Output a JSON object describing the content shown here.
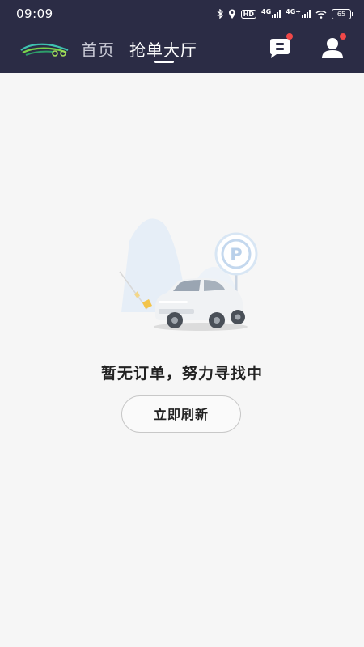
{
  "status_bar": {
    "time": "09:09",
    "hd_label": "HD",
    "net1": "4G",
    "net2": "4G+",
    "battery": "65"
  },
  "nav": {
    "tabs": [
      {
        "label": "首页",
        "active": false
      },
      {
        "label": "抢单大厅",
        "active": true
      }
    ],
    "message_icon": "message-icon",
    "user_icon": "user-icon",
    "notification_color": "#f04848",
    "header_color": "#2b2c45"
  },
  "empty_state": {
    "message": "暂无订单，努力寻找中",
    "refresh_label": "立即刷新",
    "illustration_sign": "P"
  }
}
